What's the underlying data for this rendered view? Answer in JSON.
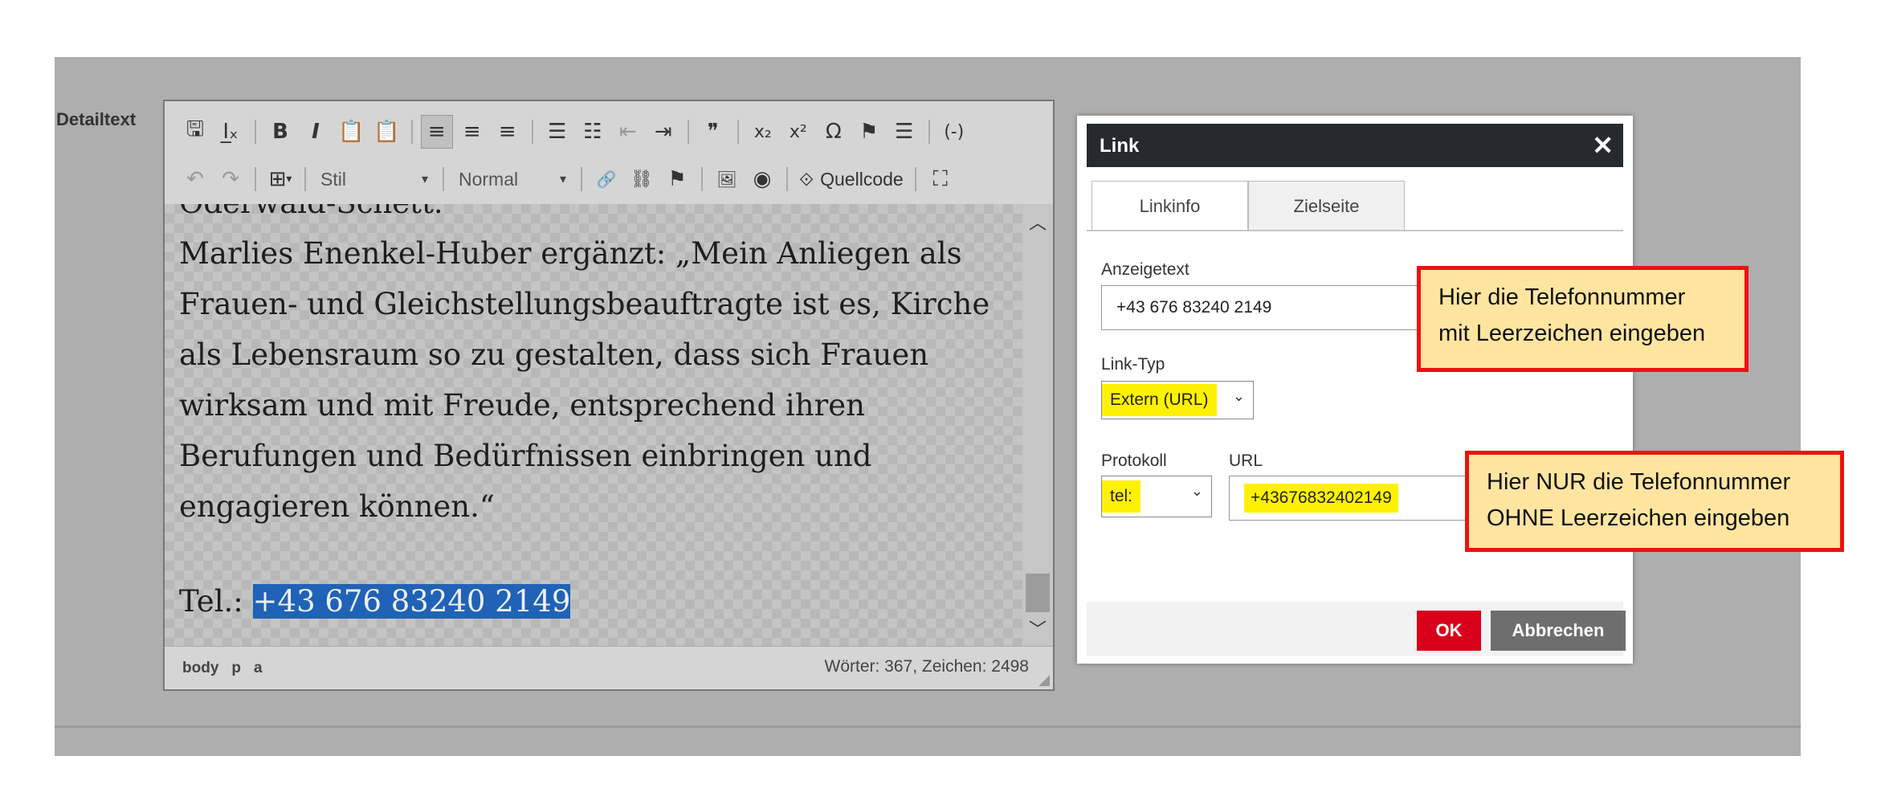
{
  "field": {
    "label": "Detailtext"
  },
  "toolbar": {
    "row1": [
      {
        "name": "save-icon",
        "glyph": "🖫",
        "state": "normal"
      },
      {
        "name": "remove-format-icon",
        "glyph": "I̲ₓ",
        "state": "normal"
      },
      {
        "name": "bold-icon",
        "glyph": "B",
        "state": "normal"
      },
      {
        "name": "italic-icon",
        "glyph": "I",
        "state": "normal"
      },
      {
        "name": "paste-text-icon",
        "glyph": "📋",
        "state": "normal"
      },
      {
        "name": "paste-word-icon",
        "glyph": "📋",
        "state": "normal"
      },
      {
        "name": "align-left-icon",
        "glyph": "≡",
        "state": "active"
      },
      {
        "name": "align-center-icon",
        "glyph": "≡",
        "state": "normal"
      },
      {
        "name": "align-right-icon",
        "glyph": "≡",
        "state": "normal"
      },
      {
        "name": "bulleted-list-icon",
        "glyph": "☰",
        "state": "normal"
      },
      {
        "name": "numbered-list-icon",
        "glyph": "☷",
        "state": "normal"
      },
      {
        "name": "outdent-icon",
        "glyph": "⇤",
        "state": "dim"
      },
      {
        "name": "indent-icon",
        "glyph": "⇥",
        "state": "normal"
      },
      {
        "name": "blockquote-icon",
        "glyph": "❞",
        "state": "normal"
      },
      {
        "name": "subscript-icon",
        "glyph": "x₂",
        "state": "normal"
      },
      {
        "name": "superscript-icon",
        "glyph": "x²",
        "state": "normal"
      },
      {
        "name": "special-char-icon",
        "glyph": "Ω",
        "state": "normal"
      },
      {
        "name": "flag-icon",
        "glyph": "⚑",
        "state": "normal"
      },
      {
        "name": "horizontal-line-icon",
        "glyph": "☰",
        "state": "normal"
      },
      {
        "name": "placeholder-icon",
        "glyph": "(-)",
        "state": "normal"
      }
    ],
    "undo_glyph": "↶",
    "redo_glyph": "↷",
    "table_glyph": "⊞",
    "style_combo": "Stil",
    "format_combo": "Normal",
    "link_glyph": "🔗",
    "unlink_glyph": "⛓",
    "anchor_glyph": "⚑",
    "image_glyph": "🖼",
    "media_glyph": "◉",
    "source_label": "Quellcode",
    "source_glyph": "⟐",
    "maximize_glyph": "⛶",
    "caret": "▾"
  },
  "content": {
    "line0": "Oderwald-Schett.",
    "paragraph": [
      "Marlies Enenkel-Huber ergänzt: „Mein Anliegen als",
      "Frauen- und Gleichstellungsbeauftragte ist es, Kirche",
      "als Lebensraum so zu gestalten, dass sich Frauen",
      "wirksam und mit Freude, entsprechend ihren",
      "Berufungen und Bedürfnissen einbringen und",
      "engagieren können.“"
    ],
    "tel_prefix": "Tel.: ",
    "tel_selected": "+43 676 83240 2149"
  },
  "statusbar": {
    "path": [
      "body",
      "p",
      "a"
    ],
    "counts": "Wörter: 367, Zeichen: 2498"
  },
  "dialog": {
    "title": "Link",
    "close": "✕",
    "tabs": [
      "Linkinfo",
      "Zielseite"
    ],
    "display_text_label": "Anzeigetext",
    "display_text_value": "+43 676 83240 2149",
    "link_type_label": "Link-Typ",
    "link_type_value": "Extern (URL)",
    "protocol_label": "Protokoll",
    "protocol_value": "tel:",
    "url_label": "URL",
    "url_value": "+43676832402149",
    "ok": "OK",
    "cancel": "Abbrechen",
    "chevron": "⌄"
  },
  "callouts": {
    "c1_line1": "Hier die Telefonnummer",
    "c1_line2": "mit Leerzeichen eingeben",
    "c2_line1": "Hier NUR die Telefonnummer",
    "c2_line2": "OHNE Leerzeichen eingeben"
  },
  "colors": {
    "highlight": "#fff200",
    "ok_button": "#d8001b",
    "callout_border": "#ee1111",
    "callout_fill": "#ffe5a0",
    "selection": "#1f62b7"
  }
}
